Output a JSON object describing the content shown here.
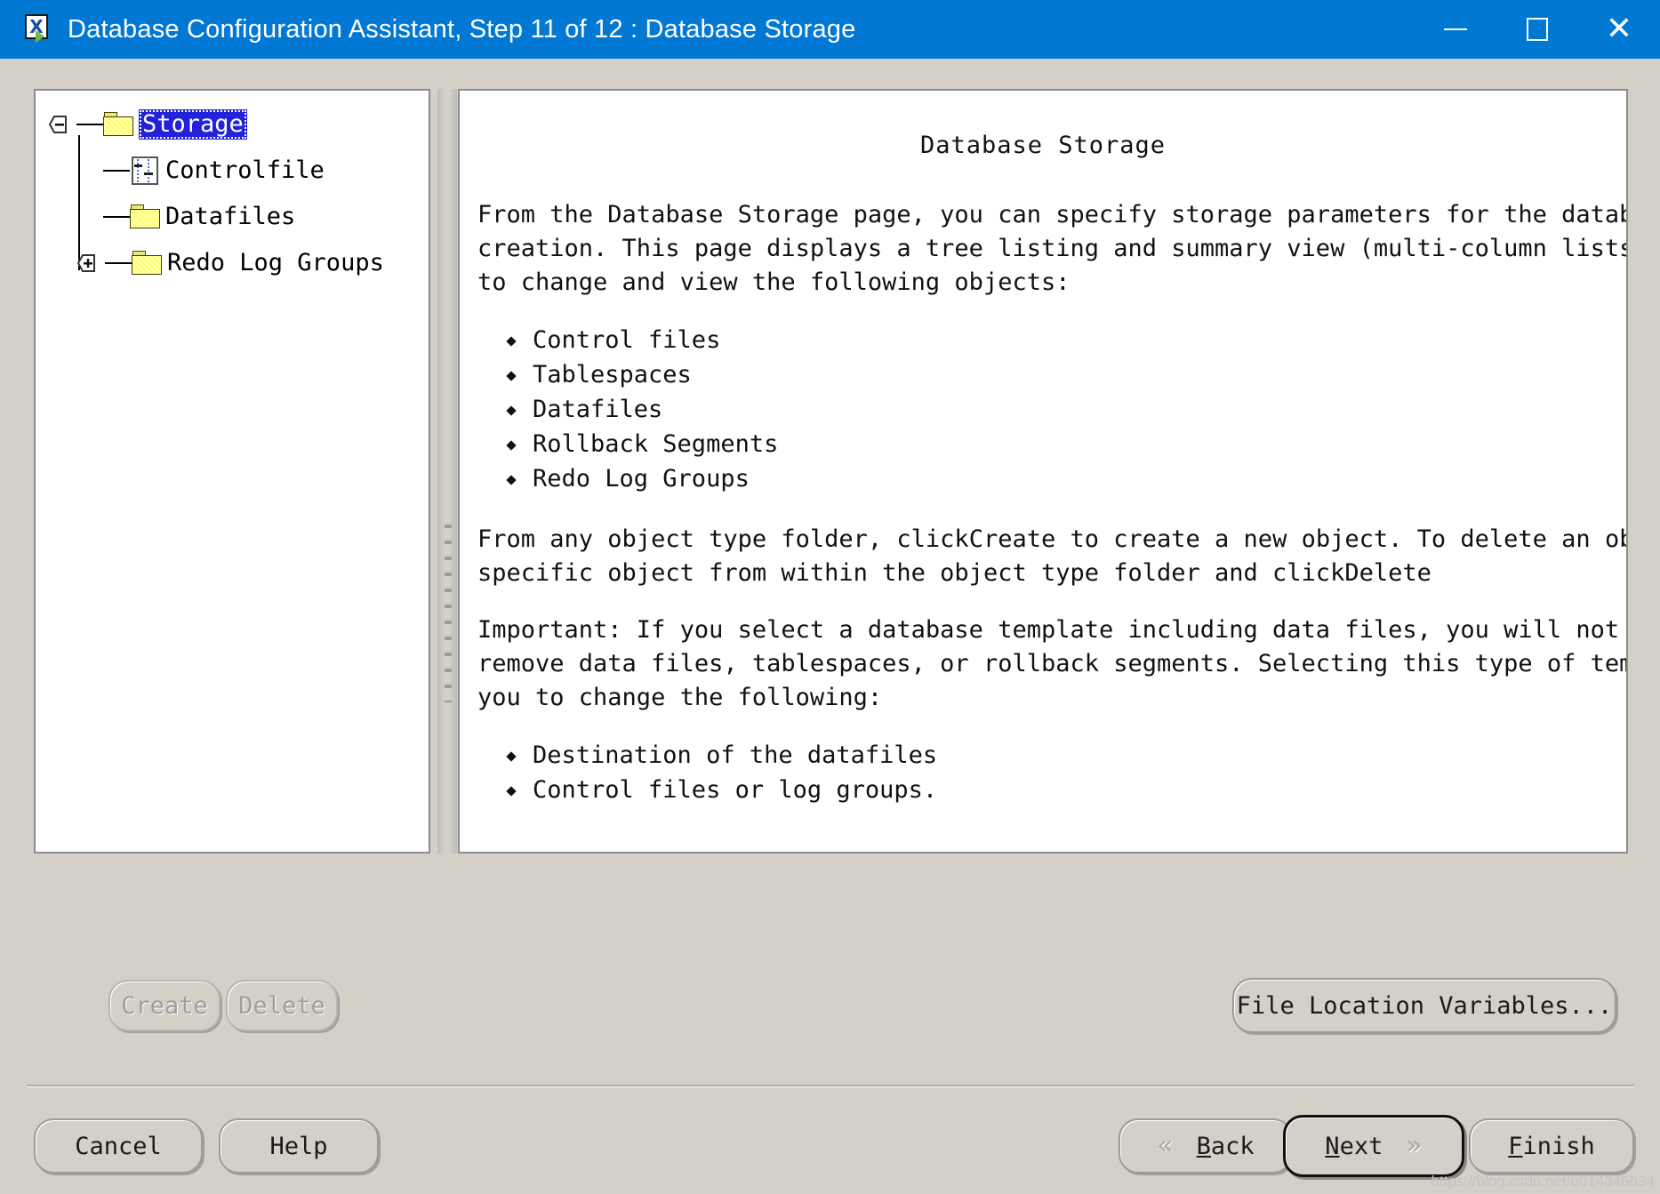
{
  "window": {
    "title": "Database Configuration Assistant, Step 11 of 12 : Database Storage",
    "icon": "oracle-dbca-icon",
    "controls": {
      "minimize": "minimize-icon",
      "maximize": "maximize-icon",
      "close": "close-icon"
    },
    "titlebar_color": "#0078d4"
  },
  "tree": {
    "nodes": [
      {
        "label": "Storage",
        "icon": "folder-icon",
        "toggle": "collapse-minus",
        "selected": true
      },
      {
        "label": "Controlfile",
        "icon": "controlfile-icon",
        "toggle": "",
        "selected": false
      },
      {
        "label": "Datafiles",
        "icon": "folder-icon",
        "toggle": "",
        "selected": false
      },
      {
        "label": "Redo Log Groups",
        "icon": "folder-icon",
        "toggle": "expand-plus",
        "selected": false
      }
    ]
  },
  "doc": {
    "title": "Database Storage",
    "para1": {
      "l1": "From the Database Storage  page, you can specify storage parameters for the database",
      "l2": "creation. This page displays a tree listing and summary view (multi-column lists) to al",
      "l3": "to change and view the following objects:"
    },
    "list1": [
      "Control files",
      "Tablespaces",
      "Datafiles",
      "Rollback Segments",
      "Redo Log Groups"
    ],
    "para2": {
      "l1_before": "From any object type folder, click",
      "l1_overlap": "Create",
      "l1_after": " to create a new object. To delete an object, selec",
      "l2_before": "specific object from within the object type folder and click",
      "l2_overlap": "Delete"
    },
    "para3": {
      "l1": "Important: If you select a database template including data files, you will not be able",
      "l2": "remove data files, tablespaces, or rollback segments. Selecting this type of template a",
      "l3": "you to change the following:"
    },
    "list2": [
      "Destination of the datafiles",
      "Control files or log groups."
    ]
  },
  "buttons": {
    "create": "Create",
    "delete": "Delete",
    "file_location_variables": "File Location Variables...",
    "cancel": "Cancel",
    "help": "Help",
    "back_mnemonic": "B",
    "back_rest": "ack",
    "next_mnemonic": "N",
    "next_rest": "ext",
    "finish_mnemonic": "F",
    "finish_rest": "inish",
    "back_chevron": "«",
    "next_chevron": "»"
  },
  "watermark": "https://blog.csdn.net/u014346634"
}
